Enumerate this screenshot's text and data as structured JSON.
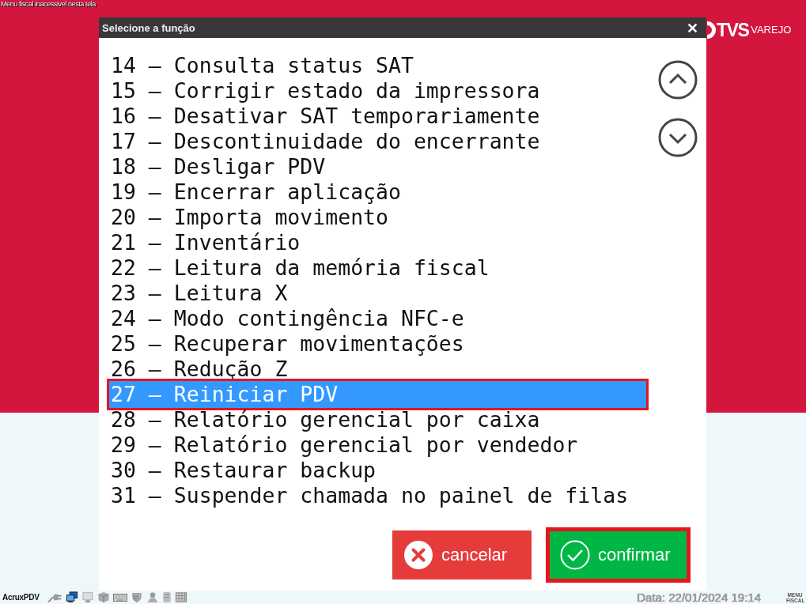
{
  "notice": "Menu fiscal inacessivel nesta tela",
  "brand": {
    "name": "TVS",
    "tagline": "VAREJO"
  },
  "dialog": {
    "title": "Selecione a função",
    "options": [
      {
        "text": "14 – Consulta status SAT",
        "selected": false
      },
      {
        "text": "15 – Corrigir estado da impressora",
        "selected": false
      },
      {
        "text": "16 – Desativar SAT temporariamente",
        "selected": false
      },
      {
        "text": "17 – Descontinuidade do encerrante",
        "selected": false
      },
      {
        "text": "18 – Desligar PDV",
        "selected": false
      },
      {
        "text": "19 – Encerrar aplicação",
        "selected": false
      },
      {
        "text": "20 – Importa movimento",
        "selected": false
      },
      {
        "text": "21 – Inventário",
        "selected": false
      },
      {
        "text": "22 – Leitura da memória fiscal",
        "selected": false
      },
      {
        "text": "23 – Leitura X",
        "selected": false
      },
      {
        "text": "24 – Modo contingência NFC-e",
        "selected": false
      },
      {
        "text": "25 – Recuperar movimentações",
        "selected": false
      },
      {
        "text": "26 – Redução Z",
        "selected": false
      },
      {
        "text": "27 – Reiniciar PDV",
        "selected": true
      },
      {
        "text": "28 – Relatório gerencial por caixa",
        "selected": false
      },
      {
        "text": "29 – Relatório gerencial por vendedor",
        "selected": false
      },
      {
        "text": "30 – Restaurar backup",
        "selected": false
      },
      {
        "text": "31 – Suspender chamada no painel de filas",
        "selected": false
      }
    ],
    "buttons": [
      {
        "kind": "cancel",
        "label": "cancelar",
        "focused": false
      },
      {
        "kind": "confirm",
        "label": "confirmar",
        "focused": true
      }
    ]
  },
  "status_bar": {
    "app": "AcruxPDV",
    "datetime": "Data: 22/01/2024 19:14",
    "menu_label": "MENU FISCAL"
  }
}
